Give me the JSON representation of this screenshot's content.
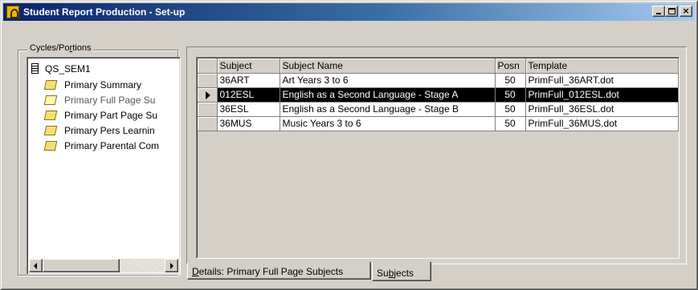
{
  "window": {
    "title": "Student Report Production - Set-up",
    "controls": {
      "minimize": "_",
      "maximize": "□",
      "close": "×"
    }
  },
  "cycles": {
    "group_label_pre": "Cycles/Po",
    "group_label_accel": "r",
    "group_label_post": "tions",
    "root": "QS_SEM1",
    "items": [
      {
        "label": "Primary Summary",
        "icon": "closed-folder-icon"
      },
      {
        "label": "Primary Full Page Su",
        "icon": "open-folder-icon",
        "selected": true
      },
      {
        "label": "Primary Part Page Su",
        "icon": "closed-folder-icon"
      },
      {
        "label": "Primary Pers Learnin",
        "icon": "closed-folder-icon"
      },
      {
        "label": "Primary Parental Com",
        "icon": "closed-folder-icon"
      }
    ]
  },
  "grid": {
    "columns": [
      "Subject",
      "Subject Name",
      "Posn",
      "Template"
    ],
    "rows": [
      {
        "subject": "36ART",
        "name": "Art Years 3 to 6",
        "posn": "50",
        "template": "PrimFull_36ART.dot",
        "selected": false
      },
      {
        "subject": "012ESL",
        "name": "English as a Second Language - Stage A",
        "posn": "50",
        "template": "PrimFull_012ESL.dot",
        "selected": true
      },
      {
        "subject": "36ESL",
        "name": "English as a Second Language - Stage B",
        "posn": "50",
        "template": "PrimFull_36ESL.dot",
        "selected": false
      },
      {
        "subject": "36MUS",
        "name": "Music Years 3 to 6",
        "posn": "50",
        "template": "PrimFull_36MUS.dot",
        "selected": false
      }
    ]
  },
  "tabs": {
    "details_accel": "D",
    "details_rest": "etails: Primary Full Page Subjects",
    "subjects_pre": "Su",
    "subjects_accel": "b",
    "subjects_post": "jects",
    "active": "Subjects"
  },
  "colors": {
    "title_gradient_start": "#0a246a",
    "title_gradient_end": "#a6caf0",
    "face": "#d4d0c8",
    "selection": "#000000"
  }
}
